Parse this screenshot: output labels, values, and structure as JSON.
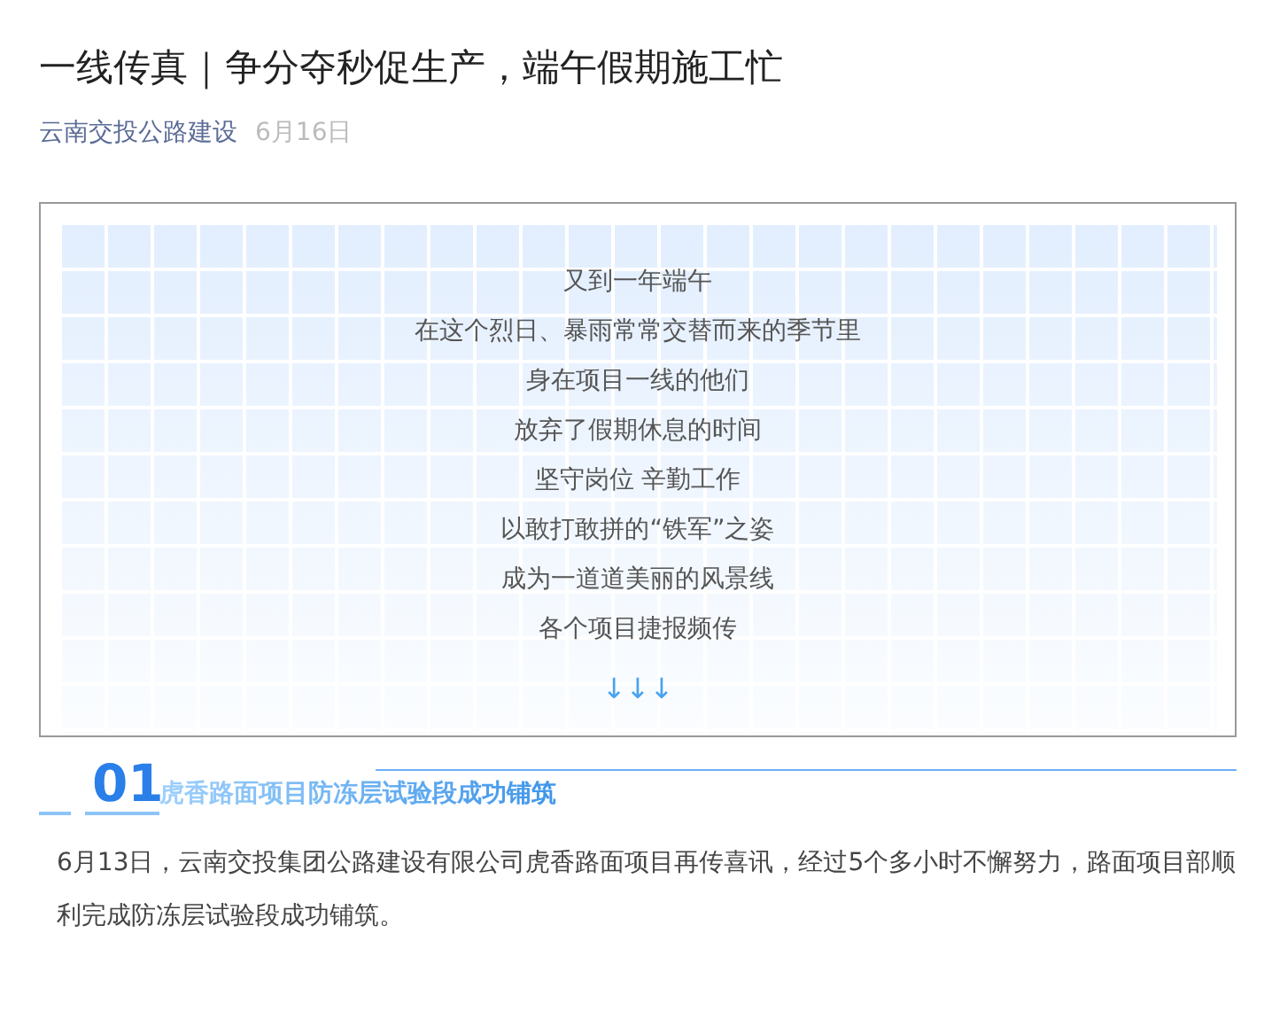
{
  "article": {
    "title": "一线传真｜争分夺秒促生产，端午假期施工忙",
    "source": "云南交投公路建设",
    "date": "6月16日"
  },
  "intro_box": {
    "lines": [
      "又到一年端午",
      "在这个烈日、暴雨常常交替而来的季节里",
      "身在项目一线的他们",
      "放弃了假期休息的时间",
      "坚守岗位 辛勤工作",
      "以敢打敢拼的“铁军”之姿",
      "成为一道道美丽的风景线",
      "各个项目捷报频传"
    ],
    "arrows": "↓↓↓"
  },
  "sections": [
    {
      "number": "01",
      "heading": "虎香路面项目防冻层试验段成功铺筑",
      "body": "6月13日，云南交投集团公路建设有限公司虎香路面项目再传喜讯，经过5个多小时不懈努力，路面项目部顺利完成防冻层试验段成功铺筑。"
    }
  ]
}
